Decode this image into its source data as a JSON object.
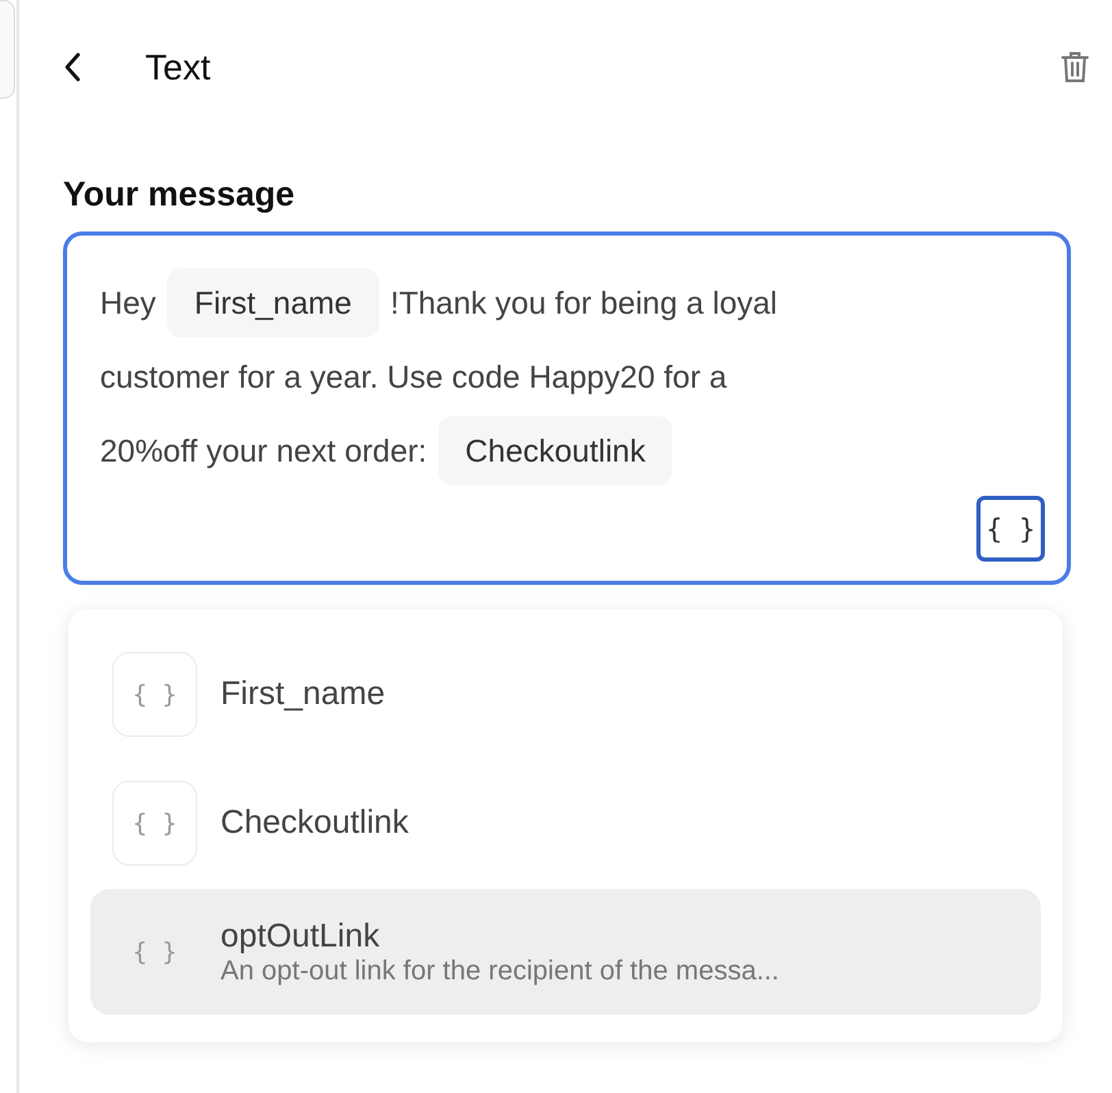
{
  "header": {
    "title": "Text"
  },
  "message": {
    "label": "Your message",
    "lines": [
      [
        {
          "kind": "text",
          "text": "Hey"
        },
        {
          "kind": "variable",
          "text": "First_name"
        },
        {
          "kind": "text",
          "text": "!Thank you for being a loyal"
        }
      ],
      [
        {
          "kind": "text",
          "text": "customer for a year. Use code Happy20 for a"
        }
      ],
      [
        {
          "kind": "text",
          "text": "20%off your next order:"
        },
        {
          "kind": "variable",
          "text": "Checkoutlink"
        }
      ]
    ],
    "insert_button": "{ }"
  },
  "variables_menu": [
    {
      "icon": "{ }",
      "name": "First_name",
      "selected": false
    },
    {
      "icon": "{ }",
      "name": "Checkoutlink",
      "selected": false
    },
    {
      "icon": "{ }",
      "name": "optOutLink",
      "description": "An opt-out link for the recipient of the messa...",
      "selected": true
    }
  ]
}
